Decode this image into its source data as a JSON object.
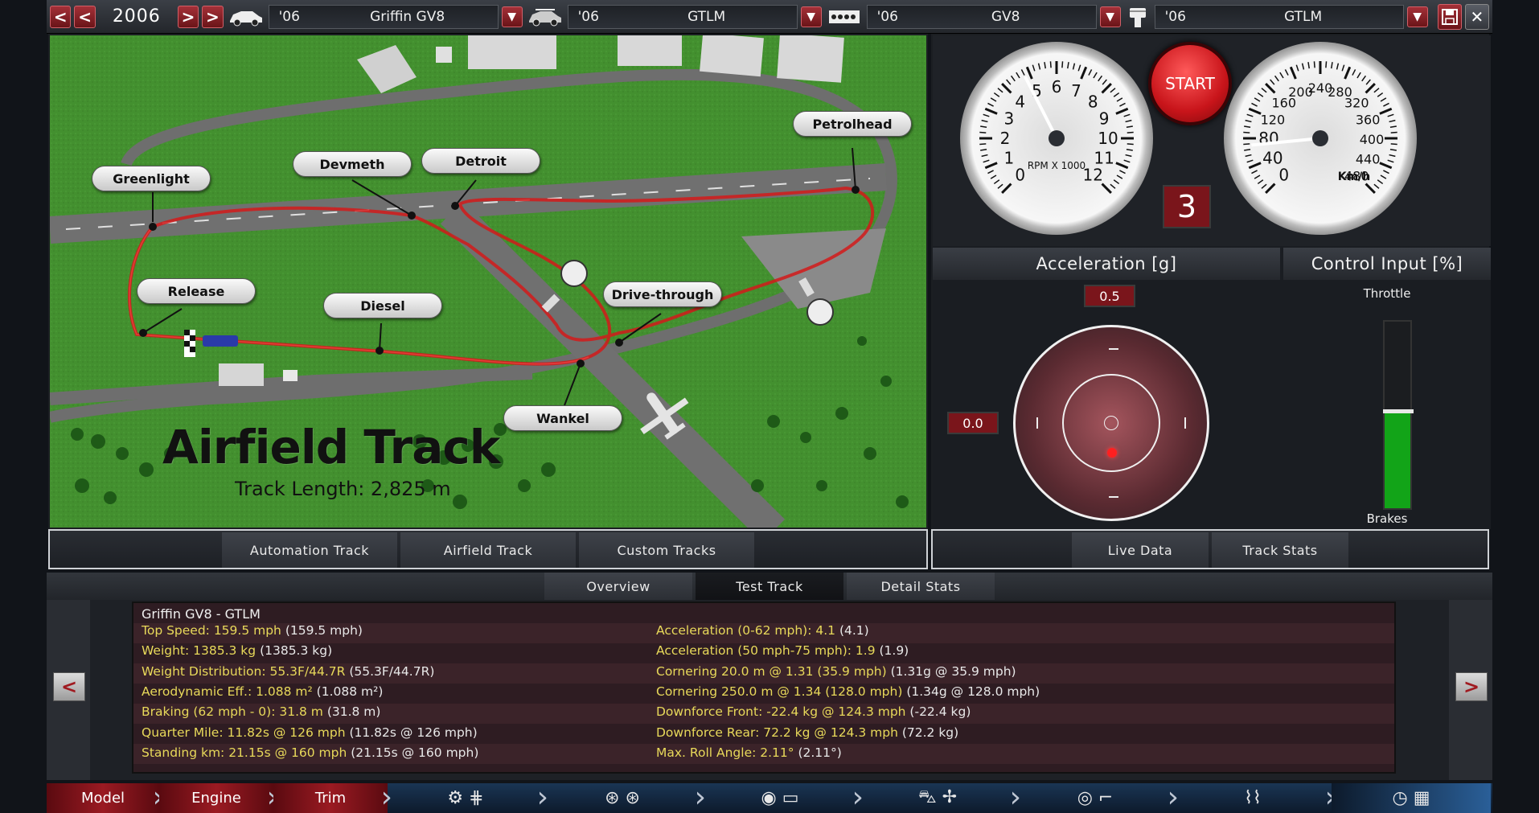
{
  "top": {
    "year": "2006",
    "selectors": [
      {
        "year": "'06",
        "name": "Griffin GV8",
        "icon": "car-body-icon"
      },
      {
        "year": "'06",
        "name": "GTLM",
        "icon": "car-trim-icon"
      },
      {
        "year": "'06",
        "name": "GV8",
        "icon": "engine-block-icon"
      },
      {
        "year": "'06",
        "name": "GTLM",
        "icon": "piston-icon"
      }
    ]
  },
  "map": {
    "track_name": "Airfield Track",
    "track_length": "Track Length: 2,825 m",
    "labels": [
      "Greenlight",
      "Devmeth",
      "Detroit",
      "Petrolhead",
      "Release",
      "Diesel",
      "Drive-through",
      "Wankel"
    ],
    "tabs": [
      "Automation Track",
      "Airfield Track",
      "Custom Tracks"
    ]
  },
  "gauges": {
    "start_label": "START",
    "rpm_label": "RPM X 1000",
    "rpm_ticks": [
      "0",
      "1",
      "2",
      "3",
      "4",
      "5",
      "6",
      "7",
      "8",
      "9",
      "10",
      "11",
      "12"
    ],
    "rpm_value": 4.8,
    "speed_label": "Km/h",
    "speed_ticks": [
      "0",
      "40",
      "80",
      "120",
      "160",
      "200",
      "240",
      "280",
      "320",
      "360",
      "400",
      "440",
      "480"
    ],
    "speed_value": 70,
    "gear": "3"
  },
  "accel": {
    "title": "Acceleration [g]",
    "long_value": "0.5",
    "lat_value": "0.0"
  },
  "control": {
    "title": "Control Input [%]",
    "throttle_label": "Throttle",
    "brakes_label": "Brakes",
    "throttle_value": 0.52
  },
  "right_tabs": [
    "Live Data",
    "Track Stats"
  ],
  "stats": {
    "tabs": [
      "Overview",
      "Test Track",
      "Detail Stats"
    ],
    "active_tab": "Test Track",
    "car_name": "Griffin GV8 - GTLM",
    "left": [
      {
        "k": "Top Speed: 159.5 mph",
        "v": "(159.5 mph)"
      },
      {
        "k": "Weight: 1385.3 kg",
        "v": "(1385.3 kg)"
      },
      {
        "k": "Weight Distribution: 55.3F/44.7R",
        "v": "(55.3F/44.7R)"
      },
      {
        "k": "Aerodynamic Eff.: 1.088 m²",
        "v": "(1.088 m²)"
      },
      {
        "k": "Braking (62 mph - 0): 31.8 m",
        "v": "(31.8 m)"
      },
      {
        "k": "Quarter Mile: 11.82s @ 126 mph",
        "v": "(11.82s @ 126 mph)"
      },
      {
        "k": "Standing km: 21.15s @ 160 mph",
        "v": "(21.15s @ 160 mph)"
      }
    ],
    "right": [
      {
        "k": "Acceleration (0-62 mph): 4.1",
        "v": "(4.1)"
      },
      {
        "k": "Acceleration (50 mph-75 mph): 1.9",
        "v": "(1.9)"
      },
      {
        "k": "Cornering 20.0 m @ 1.31 (35.9 mph)",
        "v": "(1.31g @ 35.9 mph)"
      },
      {
        "k": "Cornering 250.0 m @ 1.34 (128.0 mph)",
        "v": "(1.34g @ 128.0 mph)"
      },
      {
        "k": "Downforce Front: -22.4 kg @ 124.3 mph",
        "v": "(-22.4 kg)"
      },
      {
        "k": "Downforce Rear: 72.2 kg @ 124.3 mph",
        "v": "(72.2 kg)"
      },
      {
        "k": "Max. Roll Angle: 2.11°",
        "v": "(2.11°)"
      }
    ],
    "prev": "<",
    "next": ">"
  },
  "bottom": {
    "steps": [
      "Model",
      "Engine",
      "Trim"
    ],
    "icon_groups": [
      "gearbox-icon",
      "wheels-icon",
      "brakes-icon",
      "body-icon",
      "steering-icon",
      "suspension-icon",
      "test-track-icon"
    ]
  },
  "colors": {
    "accent_red": "#9a1a22",
    "stat_key": "#e8d95a",
    "throttle": "#12a418",
    "racing_line": "#d21a1a"
  }
}
